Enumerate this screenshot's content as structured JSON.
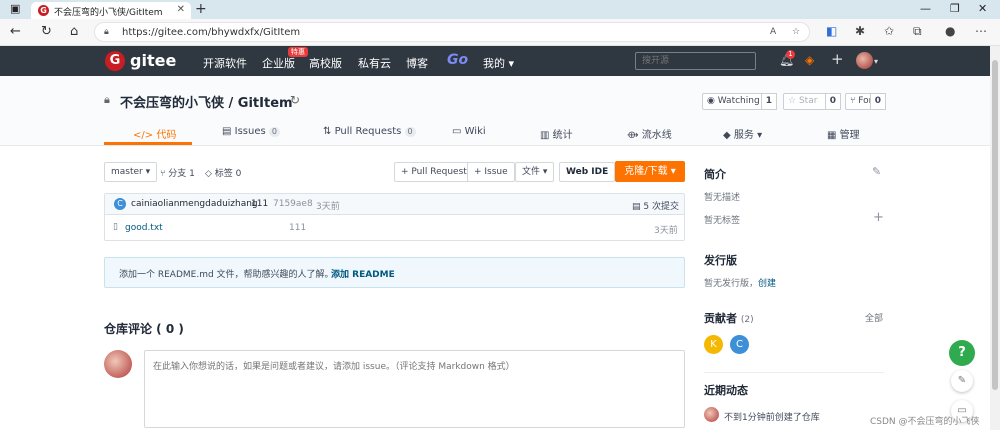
{
  "browser": {
    "tab_title": "不会压弯的小飞侠/GitItem",
    "tab_favicon": "G",
    "url": "https://gitee.com/bhywdxfx/GitItem"
  },
  "gitee_nav": {
    "logo": "gitee",
    "logo_icon": "G",
    "items": [
      "开源软件",
      "企业版",
      "高校版",
      "私有云",
      "博客"
    ],
    "special_badge": "特惠",
    "go": "Go",
    "mine": "我的 ▾",
    "search_placeholder": "搜开源",
    "notif_count": "1"
  },
  "repo": {
    "title": "不会压弯的小飞侠 / GitItem",
    "watching_label": "Watching ▾",
    "watching_count": "1",
    "star_label": "Star",
    "star_count": "0",
    "fork_label": "Fork",
    "fork_count": "0",
    "tabs": [
      {
        "label": "代码"
      },
      {
        "label": "Issues",
        "count": "0"
      },
      {
        "label": "Pull Requests",
        "count": "0"
      },
      {
        "label": "Wiki"
      },
      {
        "label": "统计"
      },
      {
        "label": "流水线"
      },
      {
        "label": "服务 ▾"
      },
      {
        "label": "管理"
      }
    ]
  },
  "toolbar": {
    "branch": "master ▾",
    "branches": "分支 1",
    "tags": "标签 0",
    "pull_request": "+ Pull Request",
    "issue": "+ Issue",
    "file": "文件 ▾",
    "web_ide": "Web IDE",
    "clone": "克隆/下载 ▾"
  },
  "commit": {
    "avatar": "C",
    "author": "cainiaolianmengdaduizhang",
    "message": "111",
    "hash": "7159ae8",
    "time": "3天前",
    "commits": "5 次提交"
  },
  "files": [
    {
      "name": "good.txt",
      "message": "111",
      "time": "3天前"
    }
  ],
  "readme": {
    "text": "添加一个 README.md 文件，帮助感兴趣的人了解。",
    "link": "添加 README"
  },
  "comments": {
    "title": "仓库评论 ( 0 )",
    "placeholder": "在此输入你想说的话，如果是问题或者建议，请添加 issue。（评论支持 Markdown 格式）"
  },
  "sidebar": {
    "intro_title": "简介",
    "no_desc": "暂无描述",
    "no_tags": "暂无标签",
    "release_title": "发行版",
    "no_release": "暂无发行版，",
    "create": "创建",
    "contrib_title": "贡献者",
    "contrib_count": "(2)",
    "contrib_all": "全部",
    "contributors": [
      {
        "letter": "K",
        "color": "#f5b800"
      },
      {
        "letter": "C",
        "color": "#3d8fd8"
      }
    ],
    "activity_title": "近期动态",
    "activity_item": "不到1分钟前创建了仓库"
  },
  "float": {
    "help": "?"
  },
  "watermark": "CSDN @不会压弯的小飞侠"
}
